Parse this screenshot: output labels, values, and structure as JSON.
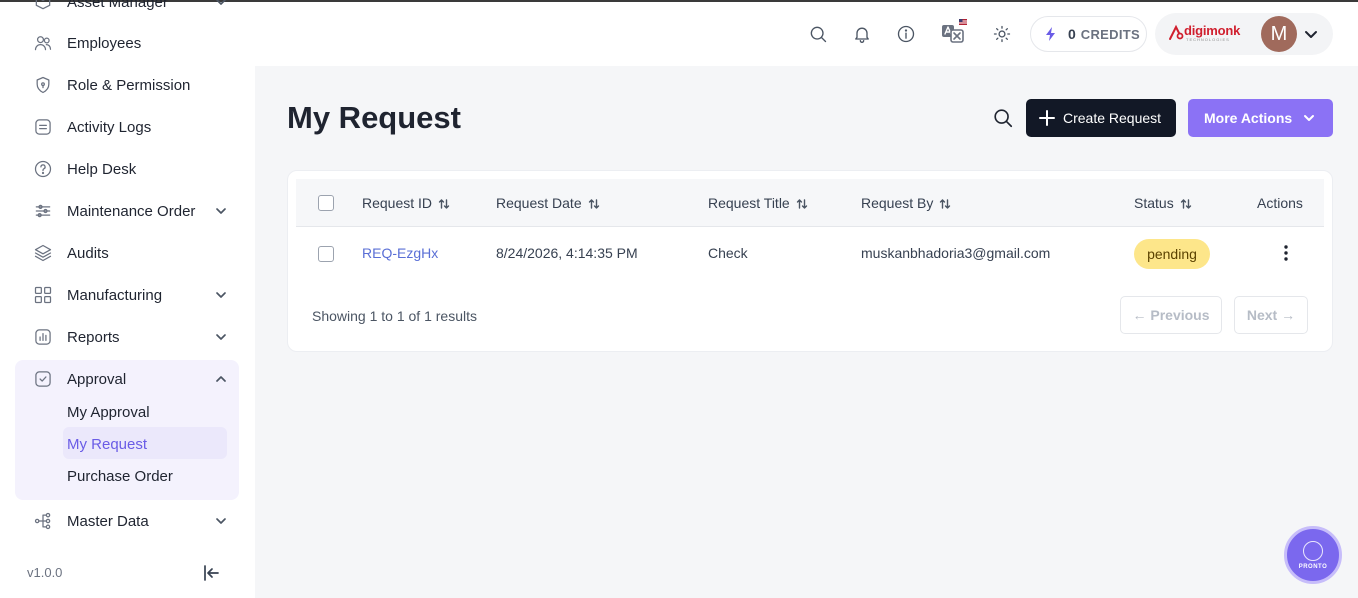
{
  "sidebar": {
    "items": [
      {
        "label": "Asset Manager"
      },
      {
        "label": "Employees"
      },
      {
        "label": "Role & Permission"
      },
      {
        "label": "Activity Logs"
      },
      {
        "label": "Help Desk"
      },
      {
        "label": "Maintenance Order"
      },
      {
        "label": "Audits"
      },
      {
        "label": "Manufacturing"
      },
      {
        "label": "Reports"
      },
      {
        "label": "Approval"
      },
      {
        "label": "Master Data"
      }
    ],
    "approval_sub": [
      {
        "label": "My Approval"
      },
      {
        "label": "My Request",
        "active": true
      },
      {
        "label": "Purchase Order"
      }
    ],
    "version": "v1.0.0"
  },
  "header": {
    "credits_count": "0",
    "credits_label": "CREDITS",
    "logo_text": "digimonk",
    "logo_sub": "TECHNOLOGIES",
    "avatar_initial": "M"
  },
  "page": {
    "title": "My Request",
    "create_label": "Create Request",
    "more_actions_label": "More Actions"
  },
  "table": {
    "columns": [
      "Request ID",
      "Request Date",
      "Request Title",
      "Request By",
      "Status",
      "Actions"
    ],
    "rows": [
      {
        "id": "REQ-EzgHx",
        "date": "8/24/2026, 4:14:35 PM",
        "title": "Check",
        "by": "muskanbhadoria3@gmail.com",
        "status": "pending"
      }
    ],
    "summary": "Showing 1 to 1 of 1 results",
    "prev_label": "← Previous",
    "next_label": "Next →"
  },
  "fab": {
    "label": "PRONTO"
  },
  "colors": {
    "accent": "#8b72f5",
    "dark_button": "#121826",
    "pending_badge": "#fde68a",
    "link": "#5a6fd6"
  }
}
